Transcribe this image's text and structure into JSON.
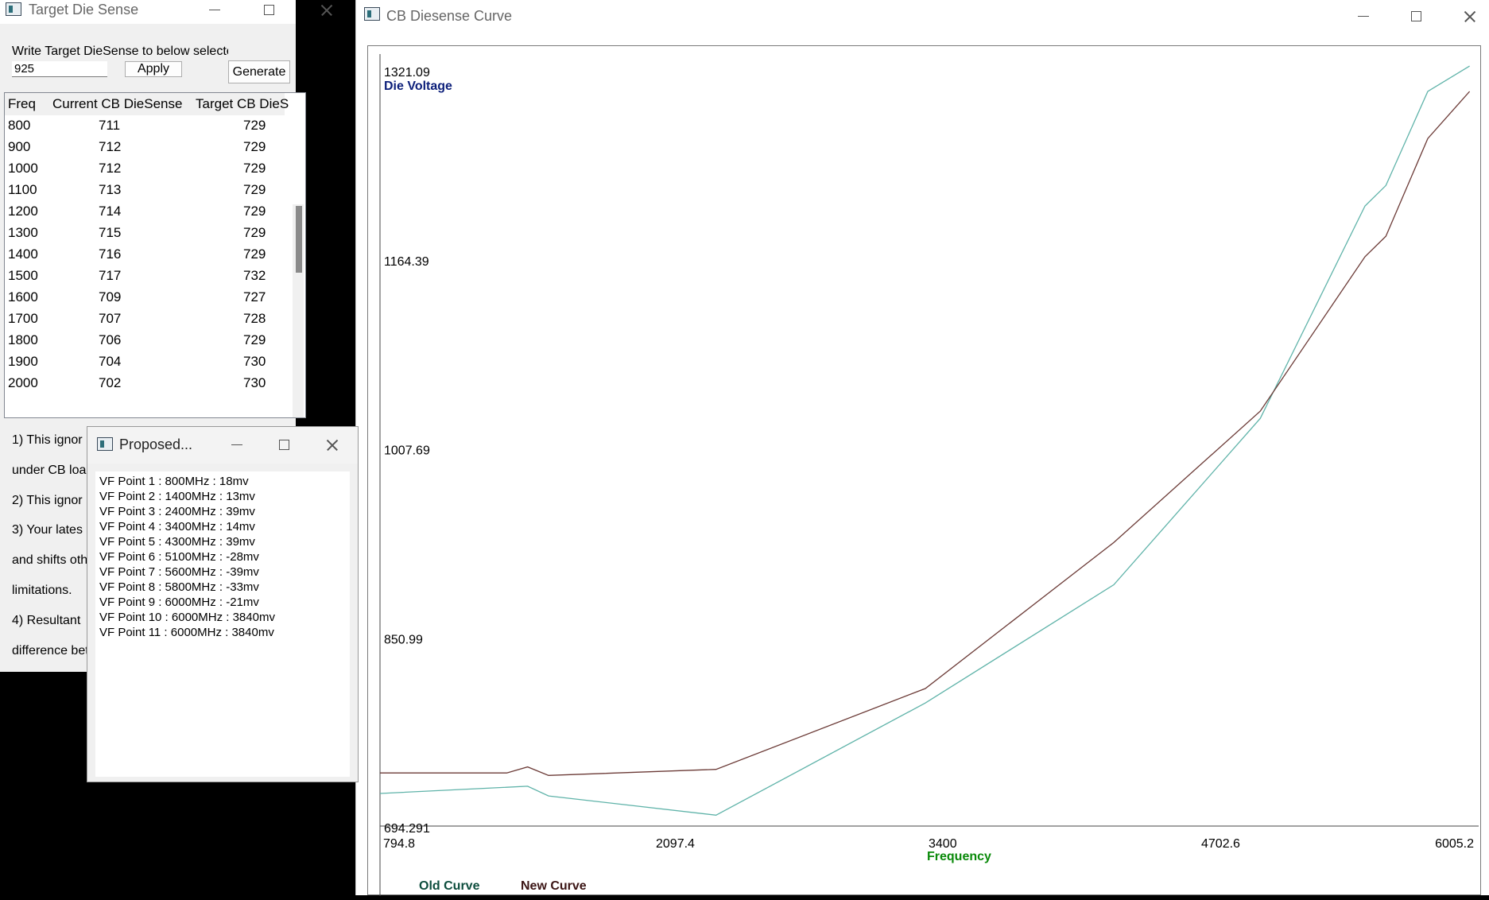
{
  "target_window": {
    "title": "Target Die Sense",
    "instruction": "Write Target DieSense to below selecte",
    "input_value": "925",
    "apply_label": "Apply",
    "generate_label": "Generate",
    "columns": [
      "Freq",
      "Current CB DieSense",
      "Target CB DieS"
    ],
    "rows": [
      [
        "800",
        "711",
        "729"
      ],
      [
        "900",
        "712",
        "729"
      ],
      [
        "1000",
        "712",
        "729"
      ],
      [
        "1100",
        "713",
        "729"
      ],
      [
        "1200",
        "714",
        "729"
      ],
      [
        "1300",
        "715",
        "729"
      ],
      [
        "1400",
        "716",
        "729"
      ],
      [
        "1500",
        "717",
        "732"
      ],
      [
        "1600",
        "709",
        "727"
      ],
      [
        "1700",
        "707",
        "728"
      ],
      [
        "1800",
        "706",
        "729"
      ],
      [
        "1900",
        "704",
        "730"
      ],
      [
        "2000",
        "702",
        "730"
      ]
    ],
    "notes": [
      "1) This ignor",
      "under CB loa",
      "2) This ignor",
      "3) Your lates",
      "and shifts oth",
      "limitations.",
      "4) Resultant",
      "difference bet"
    ]
  },
  "proposed_window": {
    "title": "Proposed...",
    "lines": [
      "VF Point 1 : 800MHz : 18mv",
      "VF Point 2 : 1400MHz : 13mv",
      "VF Point 3 : 2400MHz : 39mv",
      "VF Point 4 : 3400MHz : 14mv",
      "VF Point 5 : 4300MHz : 39mv",
      "VF Point 6 : 5100MHz : -28mv",
      "VF Point 7 : 5600MHz : -39mv",
      "VF Point 8 : 5800MHz : -33mv",
      "VF Point 9 : 6000MHz : -21mv",
      "VF Point 10 : 6000MHz : 3840mv",
      "VF Point 11 : 6000MHz : 3840mv"
    ]
  },
  "curve_window": {
    "title": "CB Diesense Curve"
  },
  "chart_data": {
    "type": "line",
    "xlabel": "Frequency",
    "ylabel": "Die Voltage",
    "xlim": [
      794.8,
      6005.2
    ],
    "ylim": [
      694.291,
      1321.09
    ],
    "x_ticks": [
      "794.8",
      "2097.4",
      "3400",
      "4702.6",
      "6005.2"
    ],
    "y_ticks": [
      "1321.09",
      "1164.39",
      "1007.69",
      "850.99",
      "694.291"
    ],
    "grid": false,
    "legend_position": "bottom-left",
    "colors": {
      "old": "#5fb3a9",
      "new": "#6b3a36",
      "xlabel": "#0a8a0a",
      "ylabel": "#0c1f7a",
      "legend_old": "#0d4d3d",
      "legend_new": "#3a1414"
    },
    "series": [
      {
        "name": "Old Curve",
        "x": [
          794.8,
          1500,
          1600,
          2400,
          3400,
          4300,
          5000,
          5500,
          5600,
          5800,
          6000
        ],
        "y": [
          718,
          724,
          716,
          700,
          793,
          891,
          1029,
          1205,
          1222,
          1300,
          1321
        ]
      },
      {
        "name": "New Curve",
        "x": [
          794.8,
          1400,
          1500,
          1600,
          2400,
          3400,
          4300,
          5000,
          5500,
          5600,
          5800,
          6000
        ],
        "y": [
          735,
          735,
          740,
          733,
          738,
          805,
          926,
          1035,
          1163,
          1180,
          1261,
          1300
        ]
      }
    ]
  }
}
